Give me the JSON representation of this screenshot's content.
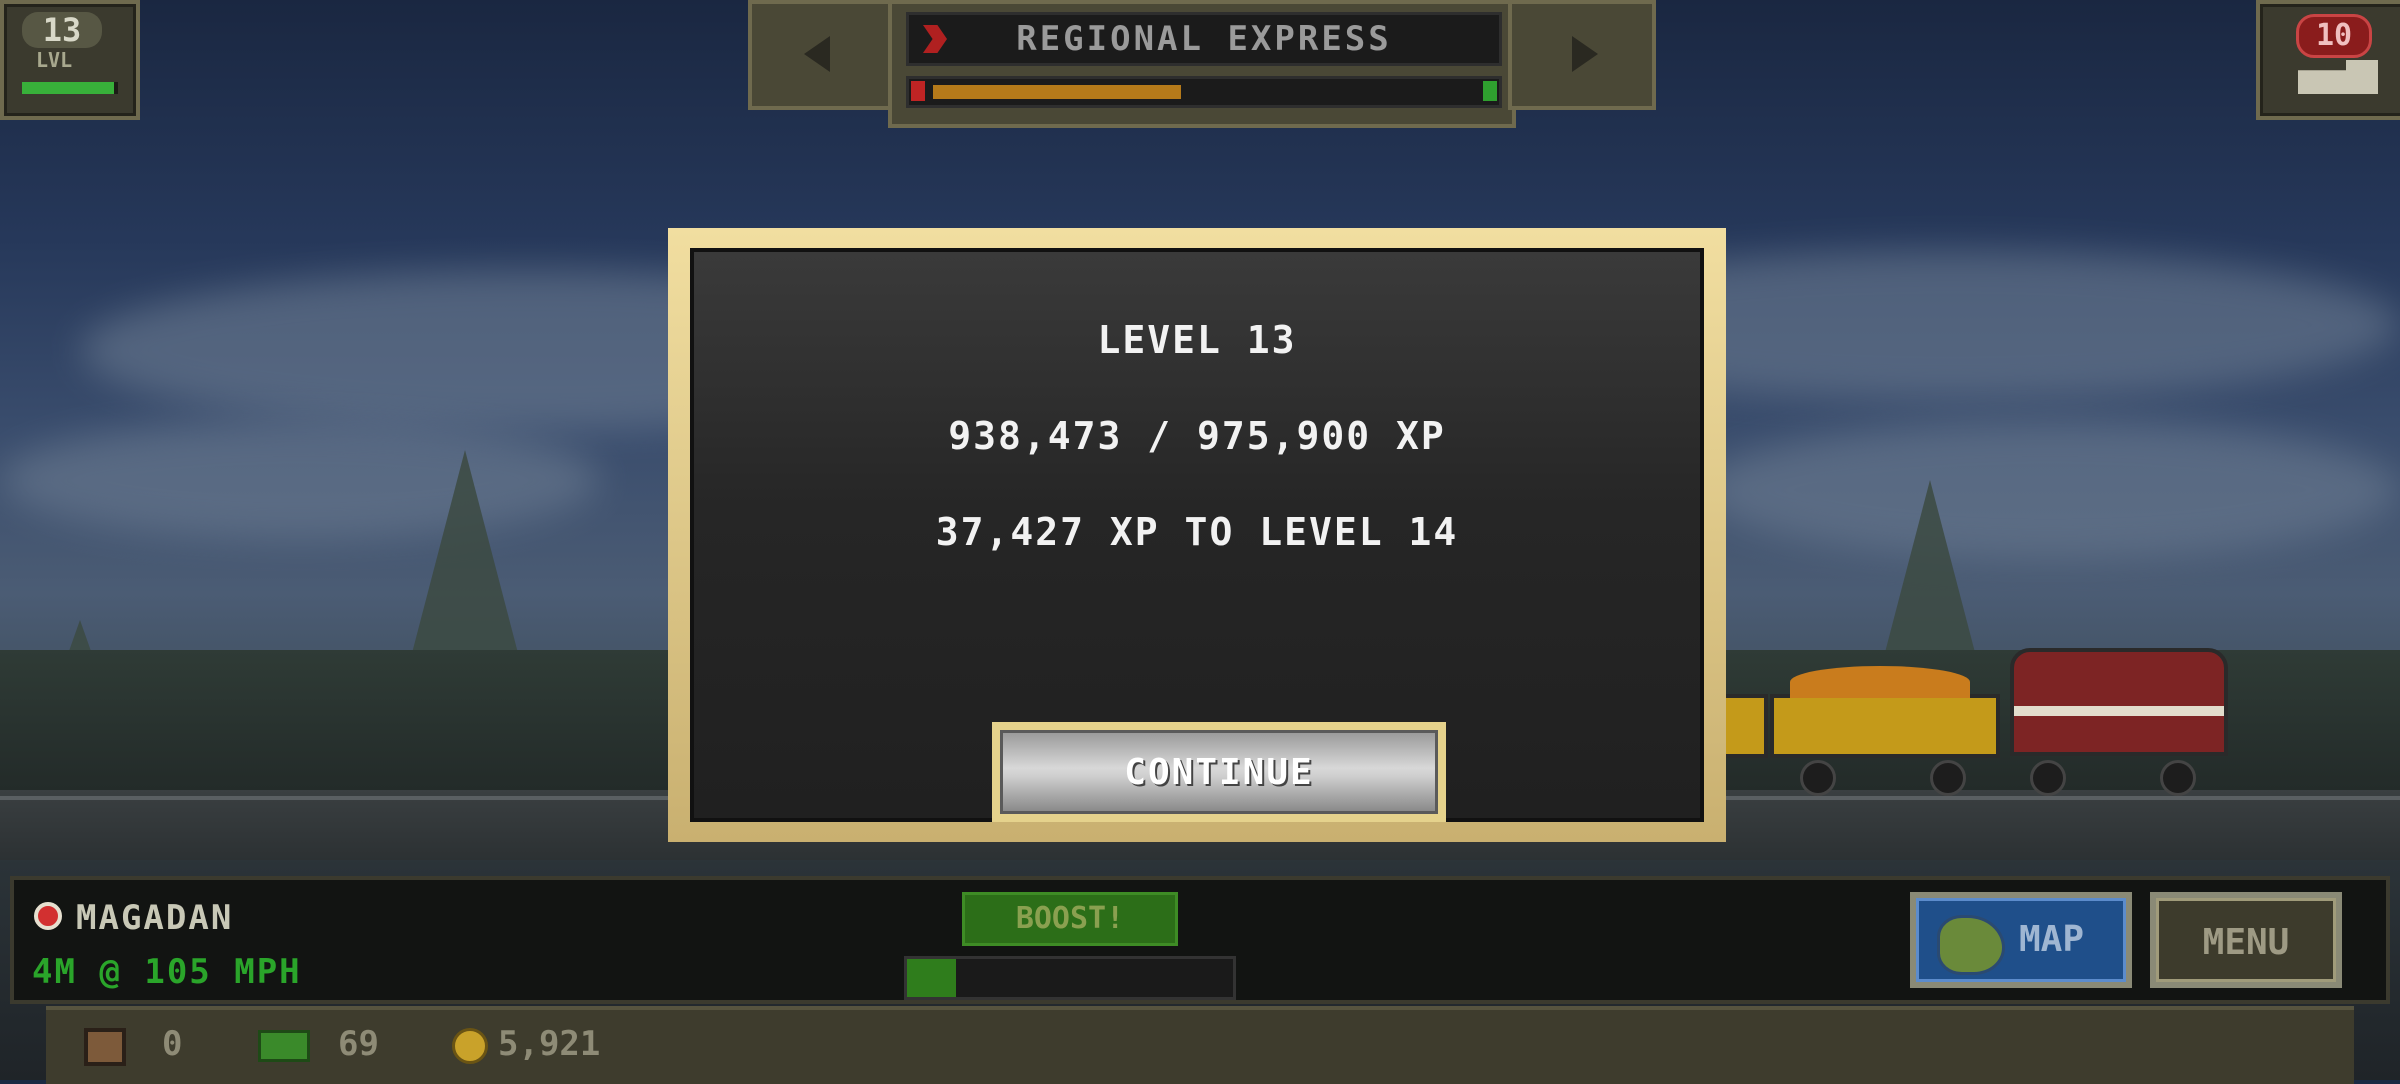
{
  "hud": {
    "level_number": "13",
    "level_label": "LVL",
    "level_progress": 0.96,
    "route_name": "REGIONAL EXPRESS",
    "route_fuel_progress": 0.46,
    "trains_count": "10"
  },
  "dialog": {
    "level_title": "LEVEL 13",
    "xp_progress": "938,473 / 975,900 XP",
    "xp_remaining": "37,427 XP TO LEVEL 14",
    "continue_label": "CONTINUE"
  },
  "status": {
    "station": "MAGADAN",
    "speed": "4M @ 105 MPH",
    "boost_label": "BOOST!",
    "boost_progress": 0.15,
    "map_label": "MAP",
    "menu_label": "MENU"
  },
  "resources": {
    "crates": "0",
    "cash": "69",
    "coins": "5,921"
  },
  "colors": {
    "modal_border": "#e5d28c",
    "modal_bg": "#262626",
    "boost_green": "#2c6e18",
    "speed_green": "#2aa52a",
    "map_blue": "#1f4f8a"
  }
}
